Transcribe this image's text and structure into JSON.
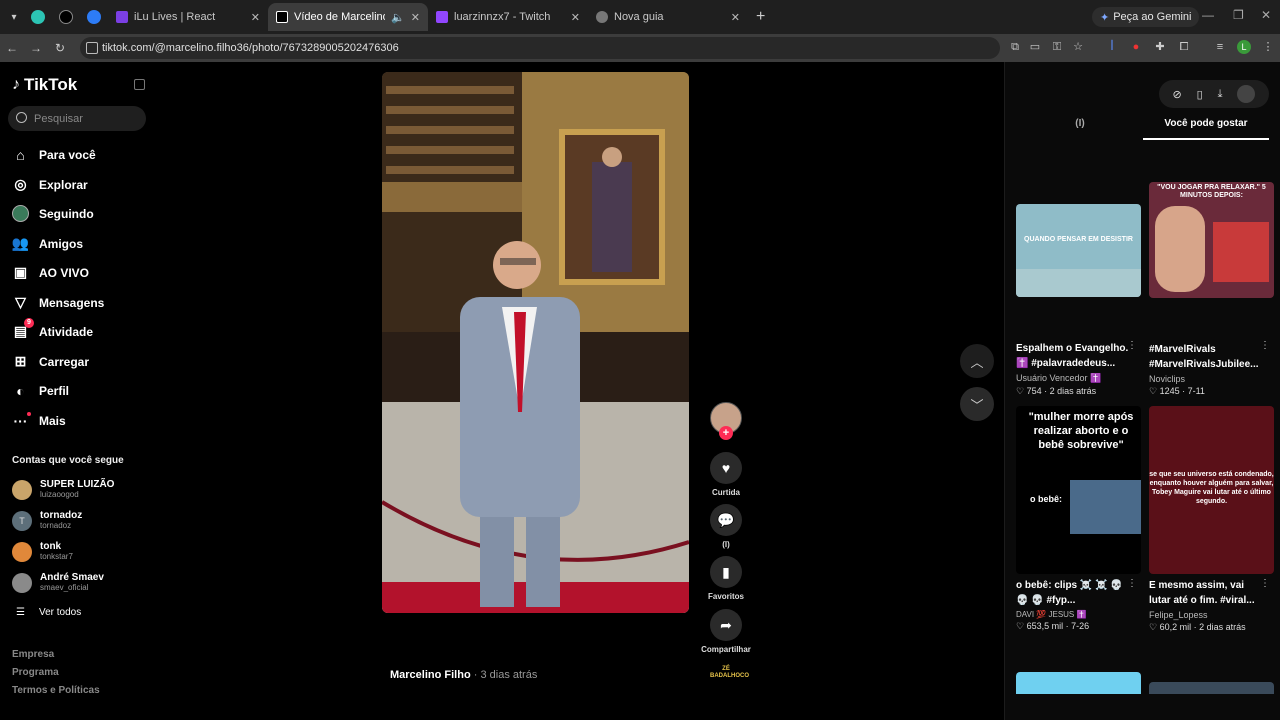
{
  "browser": {
    "tabs": [
      {
        "label": "iLu Lives | React",
        "color": "#7b3fe4",
        "active": false
      },
      {
        "label": "Vídeo de Marcelino Filho (",
        "color": "#fff",
        "active": true
      },
      {
        "label": "luarzinnzx7 - Twitch",
        "color": "#9146ff",
        "active": false
      },
      {
        "label": "Nova guia",
        "color": "#aaa",
        "active": false
      }
    ],
    "gemini_label": "Peça ao Gemini",
    "url": "tiktok.com/@marcelino.filho36/photo/7673289005202476306"
  },
  "sidebar": {
    "logo": "TikTok",
    "search_placeholder": "Pesquisar",
    "nav": [
      {
        "label": "Para você",
        "icon": "home-icon"
      },
      {
        "label": "Explorar",
        "icon": "compass-icon"
      },
      {
        "label": "Seguindo",
        "icon": "following-avatar-icon"
      },
      {
        "label": "Amigos",
        "icon": "friends-icon"
      },
      {
        "label": "AO VIVO",
        "icon": "live-icon"
      },
      {
        "label": "Mensagens",
        "icon": "messages-icon"
      },
      {
        "label": "Atividade",
        "icon": "activity-icon",
        "badge": "9"
      },
      {
        "label": "Carregar",
        "icon": "upload-icon"
      },
      {
        "label": "Perfil",
        "icon": "profile-icon"
      },
      {
        "label": "Mais",
        "icon": "more-icon"
      }
    ],
    "following_title": "Contas que você segue",
    "following": [
      {
        "name": "SUPER LUIZÃO",
        "handle": "luizaoogod",
        "color": "#c9a46a"
      },
      {
        "name": "tornadoz",
        "handle": "tornadoz",
        "color": "#5d6f7a"
      },
      {
        "name": "tonk",
        "handle": "tonkstar7",
        "color": "#e0883a"
      },
      {
        "name": "André Smaev",
        "handle": "smaev_oficial",
        "color": "#8a8a8a"
      }
    ],
    "see_all": "Ver todos",
    "footer": [
      "Empresa",
      "Programa",
      "Termos e Políticas"
    ]
  },
  "post": {
    "author": "Marcelino Filho",
    "time": " · 3 dias atrás",
    "actions": [
      {
        "label": "Curtida",
        "icon": "heart-icon"
      },
      {
        "label": "(I)",
        "icon": "comment-icon"
      },
      {
        "label": "Favoritos",
        "icon": "bookmark-icon"
      },
      {
        "label": "Compartilhar",
        "icon": "share-icon"
      }
    ],
    "sound_label": "ZÉ BADALHOCO"
  },
  "right": {
    "tabs": [
      "(I)",
      "Você pode gostar"
    ],
    "cards": [
      {
        "title": "Espalhem o Evangelho. ✝️ #palavradedeus...",
        "author": "Usuário Vencedor ✝️",
        "stats": "♡ 754 · 2 dias atrás",
        "thumb_text": "QUANDO PENSAR EM DESISTIR"
      },
      {
        "title": "#MarvelRivals #MarvelRivalsJubilee...",
        "author": "Noviclips",
        "stats": "♡ 1245 · 7-11",
        "thumb_text": "\"VOU JOGAR PRA RELAXAR.\" 5 MINUTOS DEPOIS:"
      },
      {
        "title": "o bebê: clips ☠️ ☠️ 💀 💀 💀 #fyp...",
        "author": "DAVI 💯 JESUS ✝️",
        "stats": "♡ 653,5 mil · 7-26",
        "thumb_text": "\"mulher morre após realizar aborto e o bebê sobrevive\"",
        "thumb_sub": "o bebê:"
      },
      {
        "title": "E mesmo assim, vai lutar até o fim. #viral...",
        "author": "Felipe_Lopess",
        "stats": "♡ 60,2 mil · 2 dias atrás",
        "thumb_text": "se que seu universo está condenado, enquanto houver alguém para salvar, Tobey Maguire vai lutar até o último segundo."
      }
    ]
  }
}
